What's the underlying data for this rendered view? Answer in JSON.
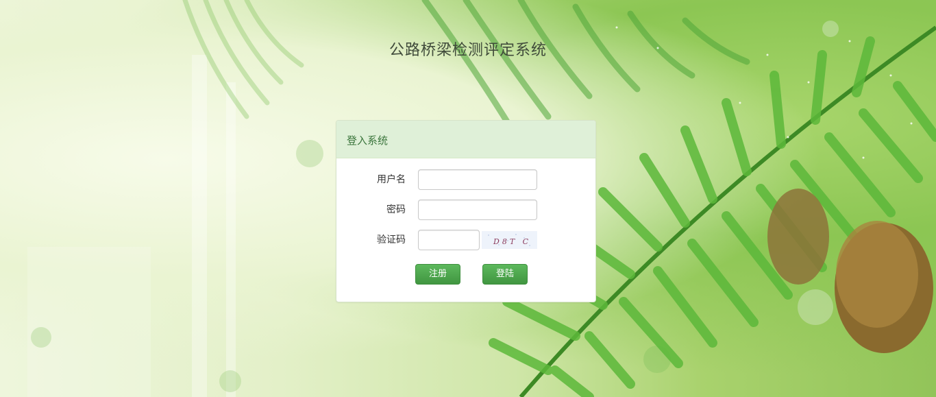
{
  "page": {
    "title": "公路桥梁检测评定系统"
  },
  "login_panel": {
    "heading": "登入系统",
    "fields": {
      "username_label": "用户名",
      "username_value": "",
      "password_label": "密码",
      "password_value": "",
      "captcha_label": "验证码",
      "captcha_value": "",
      "captcha_text": "D8T C"
    },
    "buttons": {
      "register": "注册",
      "login": "登陆"
    }
  },
  "colors": {
    "panel_heading_bg": "#dff0d8",
    "panel_heading_text": "#3c763d",
    "button_green": "#5cb85c"
  }
}
